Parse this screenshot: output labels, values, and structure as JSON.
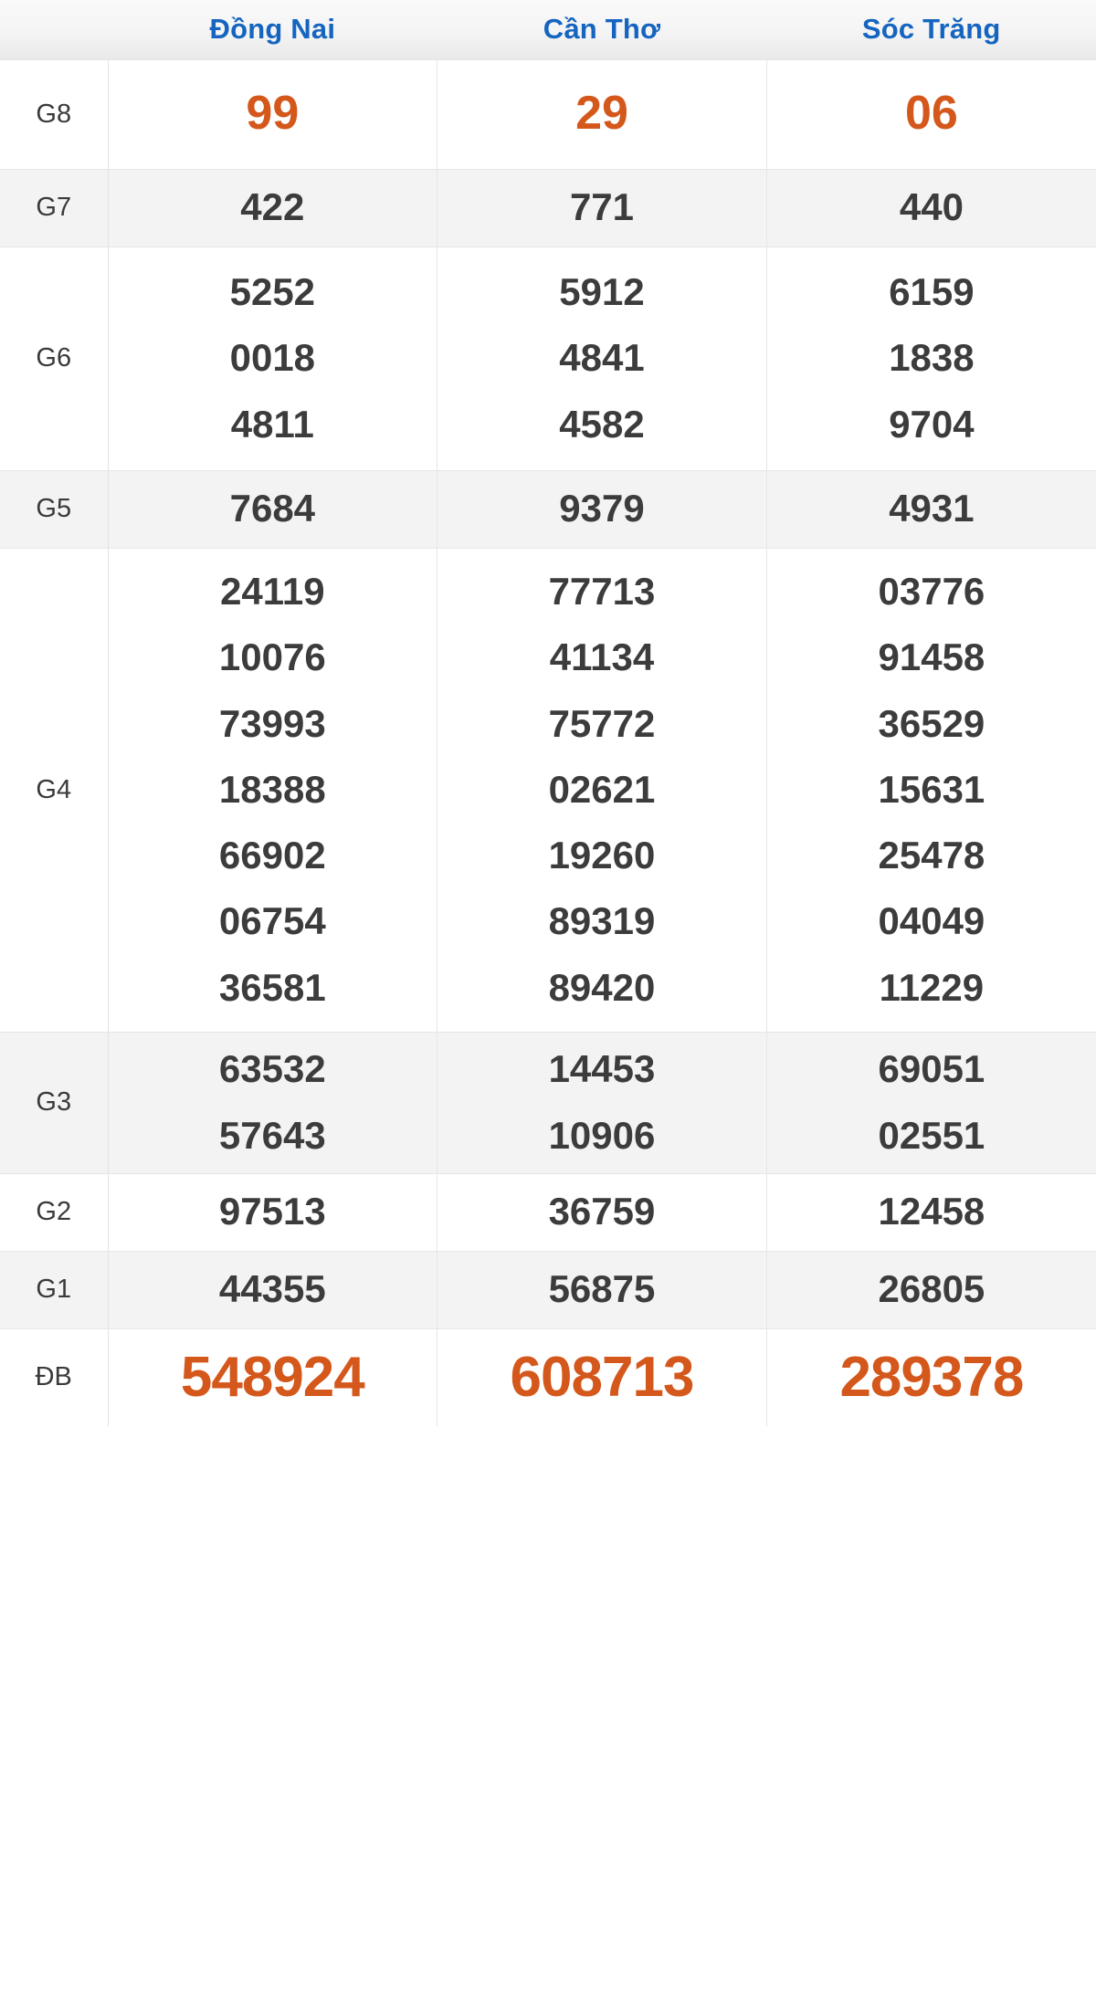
{
  "table": {
    "corner_label": "",
    "columns": [
      "Đồng Nai",
      "Cần Thơ",
      "Sóc Trăng"
    ],
    "colors": {
      "header_text": "#1565c0",
      "prize_text": "#3c3c3c",
      "special_text": "#d4571b",
      "row_white": "#ffffff",
      "row_gray": "#f3f3f3",
      "border": "#e6e6e6"
    },
    "rows": [
      {
        "label": "G8",
        "style": "special8",
        "shade": "white",
        "cells": [
          [
            "99"
          ],
          [
            "29"
          ],
          [
            "06"
          ]
        ]
      },
      {
        "label": "G7",
        "style": "normal",
        "shade": "gray",
        "cells": [
          [
            "422"
          ],
          [
            "771"
          ],
          [
            "440"
          ]
        ]
      },
      {
        "label": "G6",
        "style": "normal",
        "shade": "white",
        "cells": [
          [
            "5252",
            "0018",
            "4811"
          ],
          [
            "5912",
            "4841",
            "4582"
          ],
          [
            "6159",
            "1838",
            "9704"
          ]
        ]
      },
      {
        "label": "G5",
        "style": "normal",
        "shade": "gray",
        "cells": [
          [
            "7684"
          ],
          [
            "9379"
          ],
          [
            "4931"
          ]
        ]
      },
      {
        "label": "G4",
        "style": "normal",
        "shade": "white",
        "cells": [
          [
            "24119",
            "10076",
            "73993",
            "18388",
            "66902",
            "06754",
            "36581"
          ],
          [
            "77713",
            "41134",
            "75772",
            "02621",
            "19260",
            "89319",
            "89420"
          ],
          [
            "03776",
            "91458",
            "36529",
            "15631",
            "25478",
            "04049",
            "11229"
          ]
        ]
      },
      {
        "label": "G3",
        "style": "normal",
        "shade": "gray",
        "cells": [
          [
            "63532",
            "57643"
          ],
          [
            "14453",
            "10906"
          ],
          [
            "69051",
            "02551"
          ]
        ]
      },
      {
        "label": "G2",
        "style": "normal",
        "shade": "white",
        "cells": [
          [
            "97513"
          ],
          [
            "36759"
          ],
          [
            "12458"
          ]
        ]
      },
      {
        "label": "G1",
        "style": "normal",
        "shade": "gray",
        "cells": [
          [
            "44355"
          ],
          [
            "56875"
          ],
          [
            "26805"
          ]
        ]
      },
      {
        "label": "ĐB",
        "style": "specialdb",
        "shade": "white",
        "cells": [
          [
            "548924"
          ],
          [
            "608713"
          ],
          [
            "289378"
          ]
        ]
      }
    ]
  }
}
